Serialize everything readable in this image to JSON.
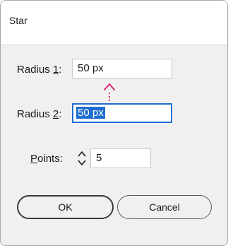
{
  "dialog": {
    "title": "Star"
  },
  "radius1": {
    "label_prefix": "Radius ",
    "label_mnemonic": "1",
    "label_suffix": ":",
    "value": "50 px"
  },
  "radius2": {
    "label_prefix": "Radius ",
    "label_mnemonic": "2",
    "label_suffix": ":",
    "value": "50 px"
  },
  "points": {
    "label_mnemonic": "P",
    "label_rest": "oints:",
    "value": "5"
  },
  "buttons": {
    "ok": "OK",
    "cancel": "Cancel"
  },
  "colors": {
    "accent": "#1f6fd1",
    "link_indicator": "#e0207a"
  },
  "icons": {
    "link": "link-indicator-icon",
    "spinner": "spinner-arrows-icon"
  }
}
